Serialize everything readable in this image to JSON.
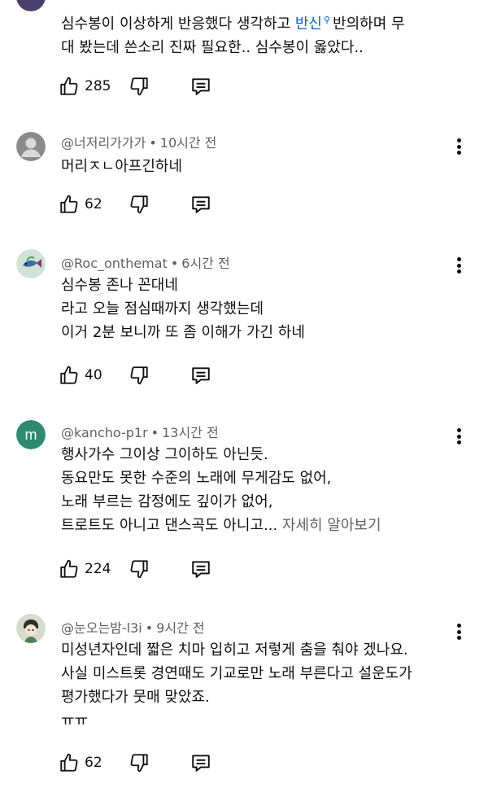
{
  "comments": [
    {
      "author": "",
      "time": "",
      "avatar_color": "#4a3f6b",
      "lines": [
        {
          "pre": "심수봉이 이상하게 반응했다 생각하고 ",
          "link": "반신",
          "post": "반의하며 무"
        },
        {
          "pre": "대 봤는데 쓴소리 진짜 필요한.. 심수봉이 옳았다..",
          "link": "",
          "post": ""
        }
      ],
      "likes": "285"
    },
    {
      "author": "@너저리가가가",
      "time": "10시간 전",
      "avatar_icon": "person-icon",
      "lines": [
        {
          "pre": "머리ㅈㄴ아프긴하네",
          "link": "",
          "post": ""
        }
      ],
      "likes": "62"
    },
    {
      "author": "@Roc_onthemat",
      "time": "6시간 전",
      "avatar_icon": "fish-icon",
      "lines": [
        {
          "pre": "심수봉 존나 꼰대네",
          "link": "",
          "post": ""
        },
        {
          "pre": "라고 오늘 점심때까지 생각했는데",
          "link": "",
          "post": ""
        },
        {
          "pre": "이거 2분 보니까 또 좀 이해가 가긴 하네",
          "link": "",
          "post": ""
        }
      ],
      "likes": "40"
    },
    {
      "author": "@kancho-p1r",
      "time": "13시간 전",
      "avatar_letter": "m",
      "avatar_color": "#2e8b6f",
      "lines": [
        {
          "pre": "행사가수 그이상 그이하도 아닌듯.",
          "link": "",
          "post": ""
        },
        {
          "pre": "동요만도 못한 수준의 노래에 무게감도 없어,",
          "link": "",
          "post": ""
        },
        {
          "pre": "노래 부르는 감정에도 깊이가 없어,",
          "link": "",
          "post": ""
        },
        {
          "pre": "트로트도 아니고 댄스곡도 아니고... ",
          "link": "",
          "post": ""
        }
      ],
      "read_more": "자세히 알아보기",
      "likes": "224"
    },
    {
      "author": "@눈오는밤-l3i",
      "time": "9시간 전",
      "avatar_icon": "character-icon",
      "lines": [
        {
          "pre": "미성년자인데 짧은 치마 입히고 저렇게 춤을 춰야 겠나요.",
          "link": "",
          "post": ""
        },
        {
          "pre": "사실 미스트롯 경연때도 기교로만 노래 부른다고 설운도가",
          "link": "",
          "post": ""
        },
        {
          "pre": "평가했다가 뭇매 맞았죠.",
          "link": "",
          "post": ""
        },
        {
          "pre": "ㅠㅠ",
          "link": "",
          "post": ""
        }
      ],
      "likes": "62"
    }
  ],
  "colors": {
    "text": "#0f0f0f",
    "meta": "#606060",
    "link": "#065fd4"
  }
}
